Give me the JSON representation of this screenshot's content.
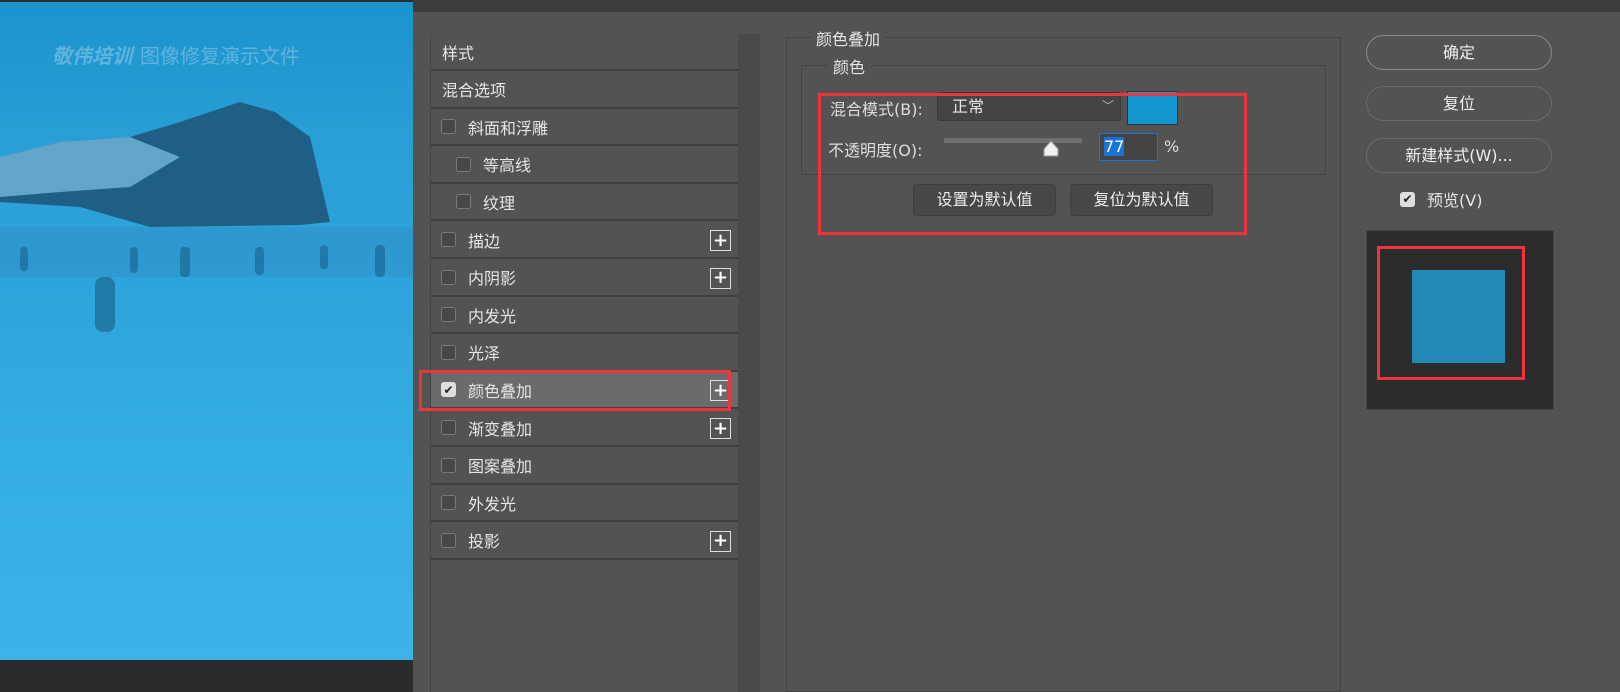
{
  "canvas": {
    "watermark_brand": "敬伟培训",
    "watermark_text": "图像修复演示文件"
  },
  "styles_list": {
    "items": [
      {
        "label": "样式",
        "type": "header"
      },
      {
        "label": "混合选项",
        "type": "header"
      },
      {
        "label": "斜面和浮雕",
        "checked": false,
        "plus": false
      },
      {
        "label": "等高线",
        "checked": false,
        "sub": true
      },
      {
        "label": "纹理",
        "checked": false,
        "sub": true
      },
      {
        "label": "描边",
        "checked": false,
        "plus": true
      },
      {
        "label": "内阴影",
        "checked": false,
        "plus": true
      },
      {
        "label": "内发光",
        "checked": false
      },
      {
        "label": "光泽",
        "checked": false
      },
      {
        "label": "颜色叠加",
        "checked": true,
        "plus": true,
        "selected": true
      },
      {
        "label": "渐变叠加",
        "checked": false,
        "plus": true
      },
      {
        "label": "图案叠加",
        "checked": false
      },
      {
        "label": "外发光",
        "checked": false
      },
      {
        "label": "投影",
        "checked": false,
        "plus": true
      }
    ]
  },
  "color_overlay": {
    "group_title": "颜色叠加",
    "subgroup_title": "颜色",
    "blend_label": "混合模式(B):",
    "blend_value": "正常",
    "overlay_color": "#1396d2",
    "opacity_label": "不透明度(O):",
    "opacity_value": "77",
    "opacity_percent": 77,
    "percent_sign": "%",
    "set_default": "设置为默认值",
    "reset_default": "复位为默认值"
  },
  "actions": {
    "ok": "确定",
    "reset": "复位",
    "new_style": "新建样式(W)...",
    "preview_label": "预览(V)",
    "preview_checked": true
  },
  "colors": {
    "highlight": "#f0353a",
    "preview_swatch": "#2389b7"
  }
}
